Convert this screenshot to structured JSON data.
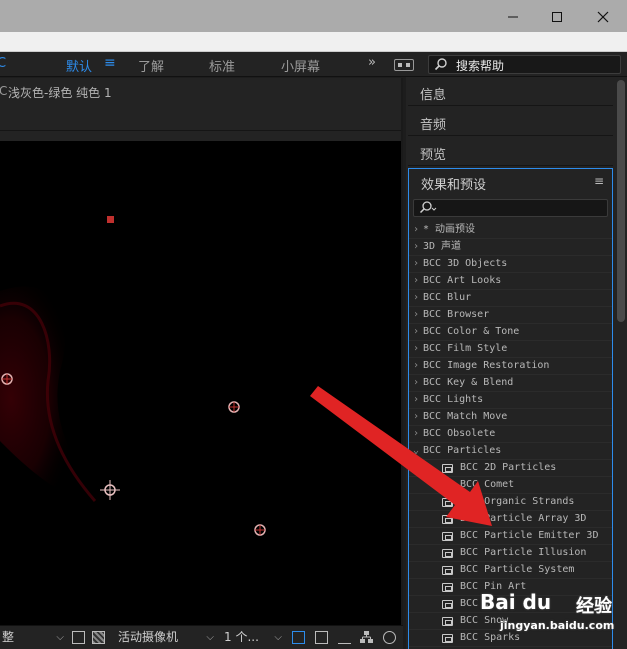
{
  "toolbar": {
    "workspace_cut": "C",
    "workspace_default": "默认",
    "workspace_menu": "≡",
    "workspace_learn": "了解",
    "workspace_standard": "标准",
    "workspace_small_screen": "小屏幕",
    "more": "»",
    "help_placeholder": "搜索帮助"
  },
  "composition": {
    "tab_cut": "C",
    "title": "浅灰色-绿色 纯色 1"
  },
  "viewer_bar": {
    "resolution": "整",
    "camera": "活动摄像机",
    "views": "1 个..."
  },
  "panels": {
    "info": "信息",
    "audio": "音频",
    "preview": "预览",
    "effects_title": "效果和预设",
    "effects_menu": "≡"
  },
  "effects": [
    {
      "label": "* 动画预设",
      "type": "folder",
      "expanded": false
    },
    {
      "label": "3D 声道",
      "type": "folder",
      "expanded": false
    },
    {
      "label": "BCC 3D Objects",
      "type": "folder",
      "expanded": false
    },
    {
      "label": "BCC Art Looks",
      "type": "folder",
      "expanded": false
    },
    {
      "label": "BCC Blur",
      "type": "folder",
      "expanded": false
    },
    {
      "label": "BCC Browser",
      "type": "folder",
      "expanded": false
    },
    {
      "label": "BCC Color & Tone",
      "type": "folder",
      "expanded": false
    },
    {
      "label": "BCC Film Style",
      "type": "folder",
      "expanded": false
    },
    {
      "label": "BCC Image Restoration",
      "type": "folder",
      "expanded": false
    },
    {
      "label": "BCC Key & Blend",
      "type": "folder",
      "expanded": false
    },
    {
      "label": "BCC Lights",
      "type": "folder",
      "expanded": false
    },
    {
      "label": "BCC Match Move",
      "type": "folder",
      "expanded": false
    },
    {
      "label": "BCC Obsolete",
      "type": "folder",
      "expanded": false
    },
    {
      "label": "BCC Particles",
      "type": "folder",
      "expanded": true
    },
    {
      "label": "BCC 2D Particles",
      "type": "effect"
    },
    {
      "label": "BCC Comet",
      "type": "effect"
    },
    {
      "label": "BCC Organic Strands",
      "type": "effect"
    },
    {
      "label": "BCC Particle Array 3D",
      "type": "effect"
    },
    {
      "label": "BCC Particle Emitter 3D",
      "type": "effect"
    },
    {
      "label": "BCC Particle Illusion",
      "type": "effect"
    },
    {
      "label": "BCC Particle System",
      "type": "effect"
    },
    {
      "label": "BCC Pin Art",
      "type": "effect"
    },
    {
      "label": "BCC ...",
      "type": "effect"
    },
    {
      "label": "BCC Snow",
      "type": "effect"
    },
    {
      "label": "BCC Sparks",
      "type": "effect"
    }
  ],
  "colors": {
    "accent": "#2d8ceb",
    "annotation_arrow": "#e02424",
    "anchor_red": "#c0302e"
  },
  "watermark": {
    "logo": "Bai du",
    "text": "经验",
    "url": "jingyan.baidu.com"
  }
}
